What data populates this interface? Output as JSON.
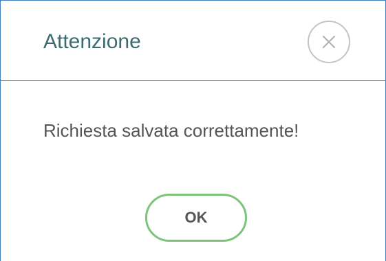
{
  "dialog": {
    "title": "Attenzione",
    "message": "Richiesta salvata correttamente!",
    "ok_label": "OK",
    "close_icon": "close-icon"
  },
  "colors": {
    "border": "#3d7fc0",
    "title_text": "#3b6b70",
    "ok_border": "#7cc47a",
    "close_border": "#c4c4c4"
  }
}
